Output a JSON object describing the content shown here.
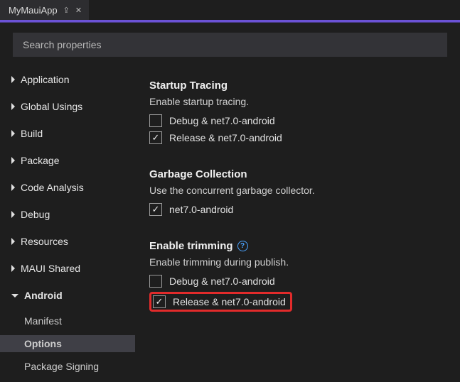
{
  "tab": {
    "title": "MyMauiApp"
  },
  "search": {
    "placeholder": "Search properties"
  },
  "nav": {
    "items": [
      {
        "label": "Application"
      },
      {
        "label": "Global Usings"
      },
      {
        "label": "Build"
      },
      {
        "label": "Package"
      },
      {
        "label": "Code Analysis"
      },
      {
        "label": "Debug"
      },
      {
        "label": "Resources"
      },
      {
        "label": "MAUI Shared"
      }
    ],
    "android": {
      "label": "Android",
      "children": [
        {
          "label": "Manifest"
        },
        {
          "label": "Options"
        },
        {
          "label": "Package Signing"
        }
      ]
    }
  },
  "sections": {
    "startup": {
      "title": "Startup Tracing",
      "desc": "Enable startup tracing.",
      "opts": [
        {
          "label": "Debug & net7.0-android",
          "checked": false
        },
        {
          "label": "Release & net7.0-android",
          "checked": true
        }
      ]
    },
    "gc": {
      "title": "Garbage Collection",
      "desc": "Use the concurrent garbage collector.",
      "opts": [
        {
          "label": "net7.0-android",
          "checked": true
        }
      ]
    },
    "trim": {
      "title": "Enable trimming",
      "desc": "Enable trimming during publish.",
      "opts": [
        {
          "label": "Debug & net7.0-android",
          "checked": false
        },
        {
          "label": "Release & net7.0-android",
          "checked": true
        }
      ]
    },
    "help": "?"
  }
}
